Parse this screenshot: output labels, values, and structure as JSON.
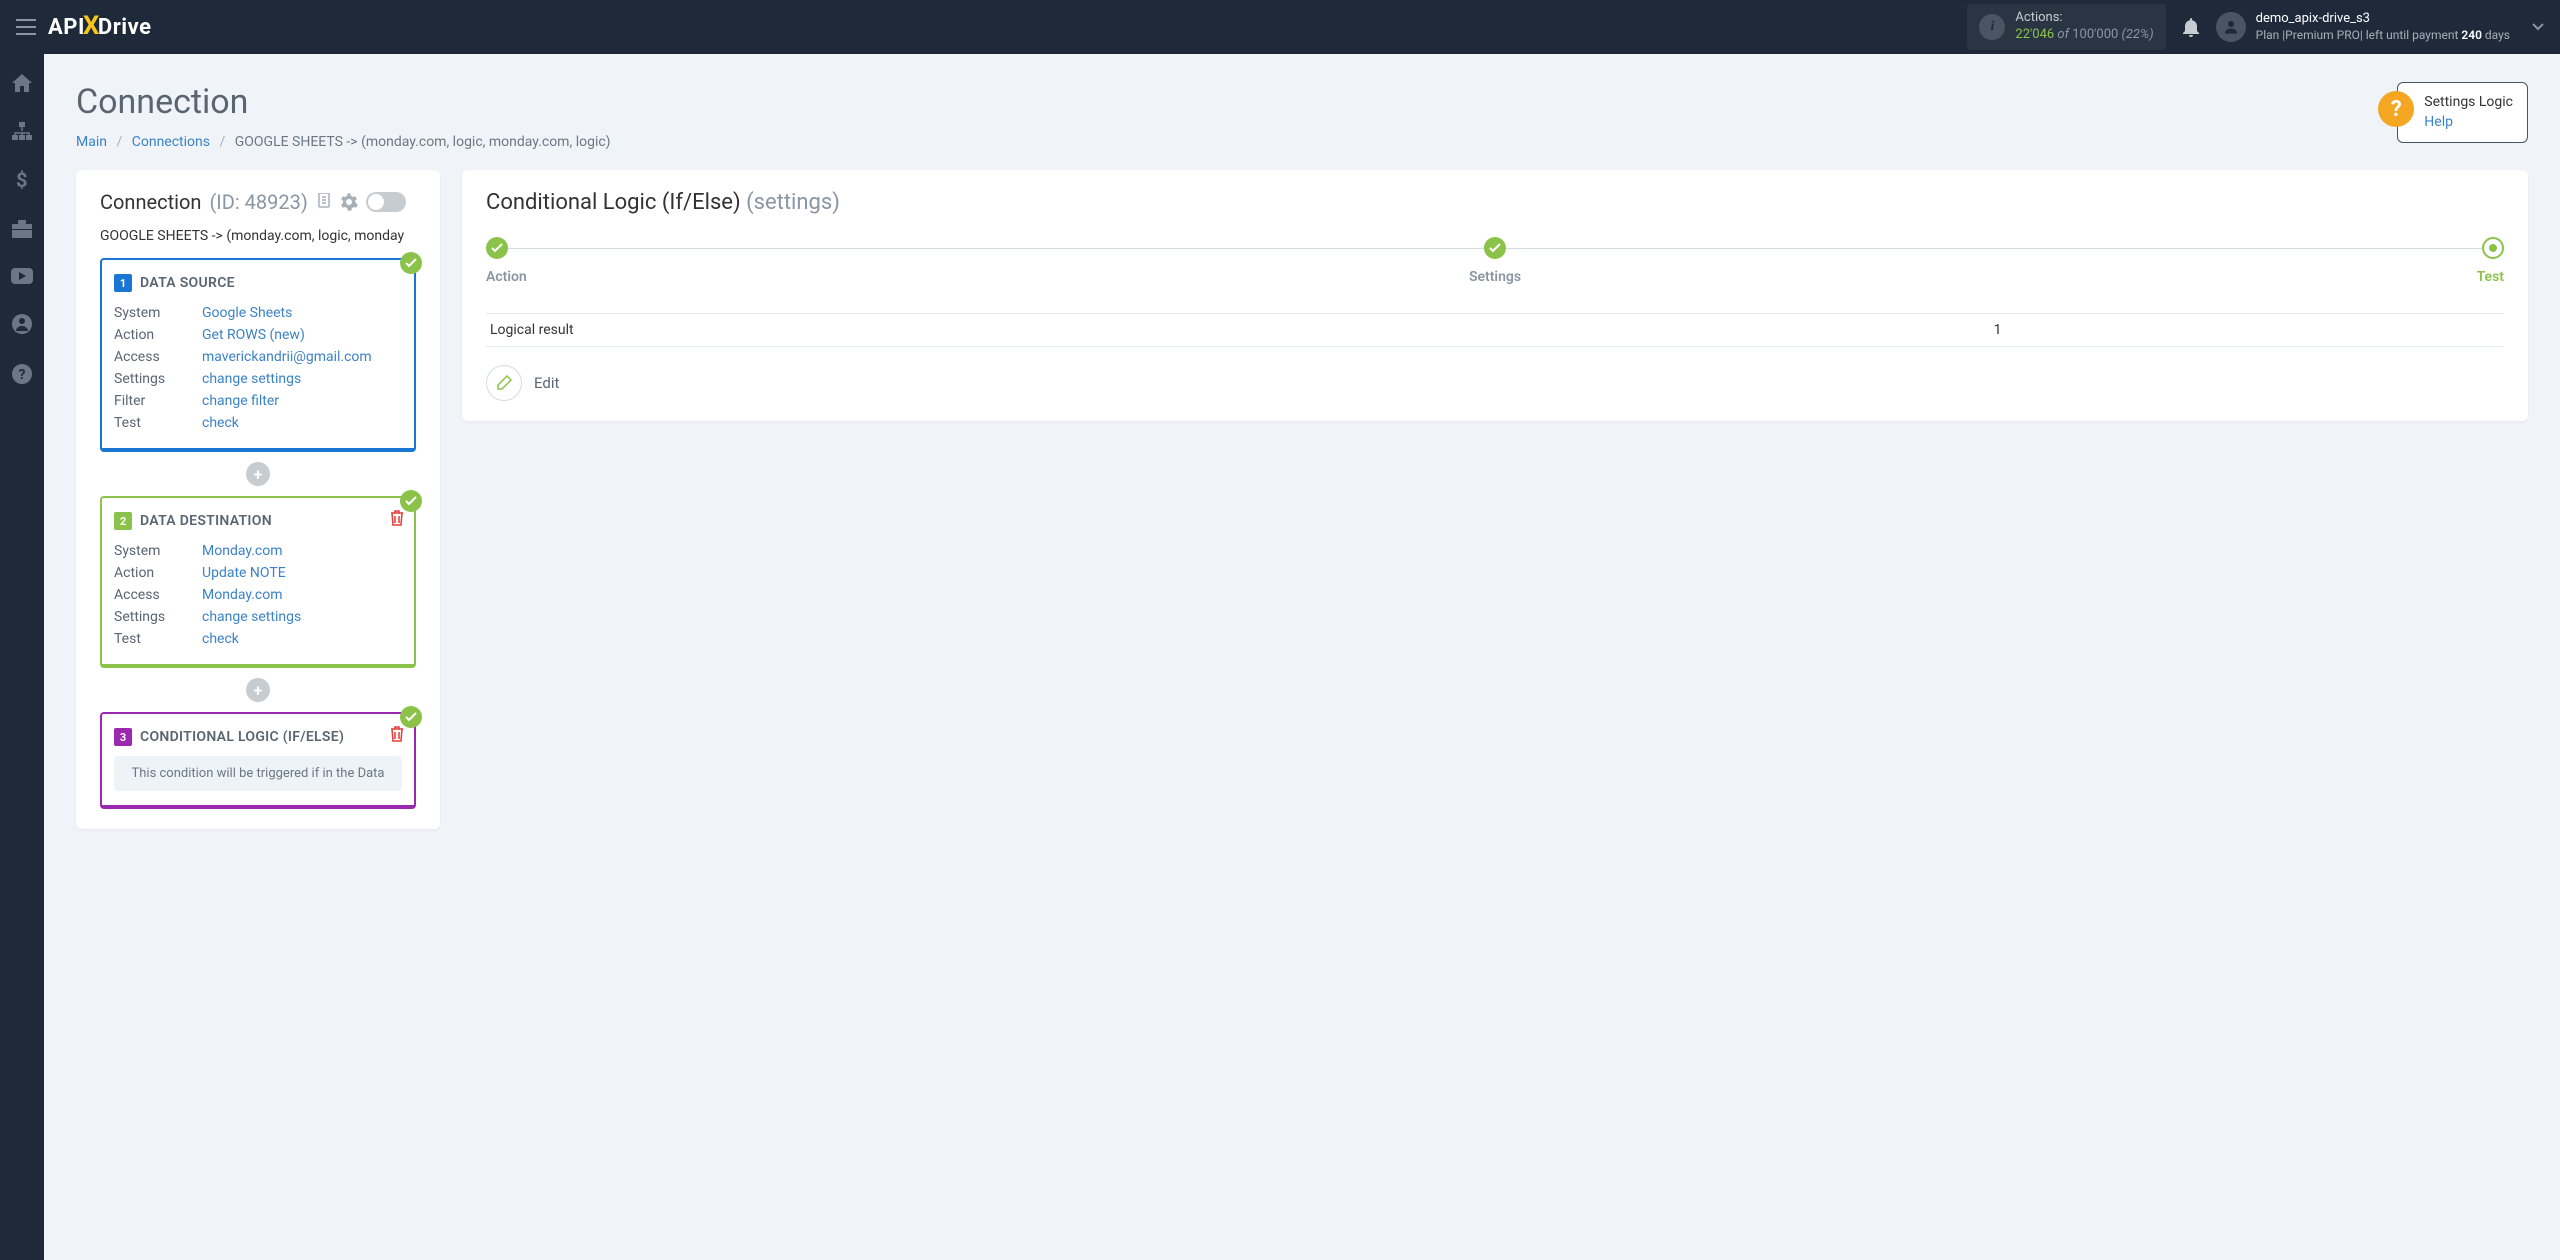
{
  "topbar": {
    "logo_pre": "API",
    "logo_x": "X",
    "logo_post": "Drive",
    "actions_label": "Actions:",
    "actions_count": "22'046",
    "actions_of": " of ",
    "actions_total": "100'000",
    "actions_pct": " (22%)",
    "username": "demo_apix-drive_s3",
    "plan_prefix": "Plan |Premium PRO| left until payment ",
    "plan_days": "240",
    "plan_suffix": " days"
  },
  "page": {
    "title": "Connection",
    "breadcrumb": {
      "main": "Main",
      "connections": "Connections",
      "current": "GOOGLE SHEETS -> (monday.com, logic, monday.com, logic)"
    }
  },
  "help": {
    "title": "Settings Logic",
    "link": "Help"
  },
  "connection": {
    "label": "Connection",
    "id_label": "(ID: 48923)",
    "path": "GOOGLE SHEETS -> (monday.com, logic, monday"
  },
  "blocks": [
    {
      "num": "1",
      "title": "DATA SOURCE",
      "rows": [
        {
          "label": "System",
          "value": "Google Sheets"
        },
        {
          "label": "Action",
          "value": "Get ROWS (new)"
        },
        {
          "label": "Access",
          "value": "maverickandrii@gmail.com"
        },
        {
          "label": "Settings",
          "value": "change settings"
        },
        {
          "label": "Filter",
          "value": "change filter"
        },
        {
          "label": "Test",
          "value": "check"
        }
      ]
    },
    {
      "num": "2",
      "title": "DATA DESTINATION",
      "rows": [
        {
          "label": "System",
          "value": "Monday.com"
        },
        {
          "label": "Action",
          "value": "Update NOTE"
        },
        {
          "label": "Access",
          "value": "Monday.com"
        },
        {
          "label": "Settings",
          "value": "change settings"
        },
        {
          "label": "Test",
          "value": "check"
        }
      ]
    },
    {
      "num": "3",
      "title": "CONDITIONAL LOGIC (IF/ELSE)",
      "note": "This condition will be triggered if in the Data"
    }
  ],
  "right": {
    "title": "Conditional Logic (If/Else)",
    "subtitle": " (settings)",
    "steps": {
      "action": "Action",
      "settings": "Settings",
      "test": "Test"
    },
    "result_label": "Logical result",
    "result_value": "1",
    "edit_label": "Edit"
  }
}
